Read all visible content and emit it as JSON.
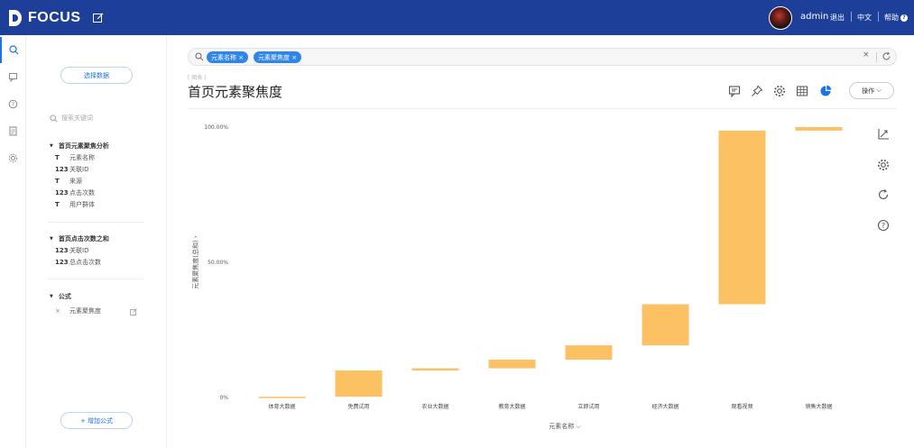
{
  "header": {
    "brand": "FOCUS",
    "user": "admin",
    "logout": "退出",
    "language": "中文",
    "help": "帮助",
    "brand_color": "#1d3f99"
  },
  "rail": {
    "icons": [
      "search-icon",
      "bookmark-icon",
      "help-circle-icon",
      "document-icon",
      "gear-icon"
    ]
  },
  "panel": {
    "select_data": "选择数据",
    "search_placeholder": "搜索关键词",
    "groups": [
      {
        "title": "首页元素聚焦分析",
        "fields": [
          {
            "type": "T",
            "name": "元素名称"
          },
          {
            "type": "123",
            "name": "关联ID"
          },
          {
            "type": "T",
            "name": "来源"
          },
          {
            "type": "123",
            "name": "点击次数"
          },
          {
            "type": "T",
            "name": "用户群体"
          }
        ]
      },
      {
        "title": "首页点击次数之和",
        "fields": [
          {
            "type": "123",
            "name": "关联ID"
          },
          {
            "type": "123",
            "name": "总点击次数"
          }
        ]
      },
      {
        "title": "公式",
        "fields": [
          {
            "type": "×",
            "name": "元素聚焦度"
          }
        ]
      }
    ],
    "add_formula": "+ 增加公式"
  },
  "query": {
    "tags": [
      "元素名称",
      "元素聚焦度"
    ],
    "clear": "×"
  },
  "report": {
    "breadcrumb": "[ 图表 ]",
    "title": "首页元素聚焦度",
    "operate": "操作"
  },
  "chart_data": {
    "type": "bar",
    "subtype": "waterfall",
    "categories": [
      "体育大数据",
      "免费试用",
      "农业大数据",
      "教育大数据",
      "立即试用",
      "经济大数据",
      "观看视频",
      "销售大数据"
    ],
    "values": [
      0.3,
      9.7,
      0.8,
      3.2,
      5.3,
      15.2,
      64.2,
      1.3
    ],
    "bar_color": "#fcc162",
    "ylabel": "元素聚焦度(总和)",
    "xlabel": "元素名称",
    "y_ticks": [
      "0%",
      "50.00%",
      "100.00%"
    ],
    "ylim": [
      0,
      100
    ]
  }
}
